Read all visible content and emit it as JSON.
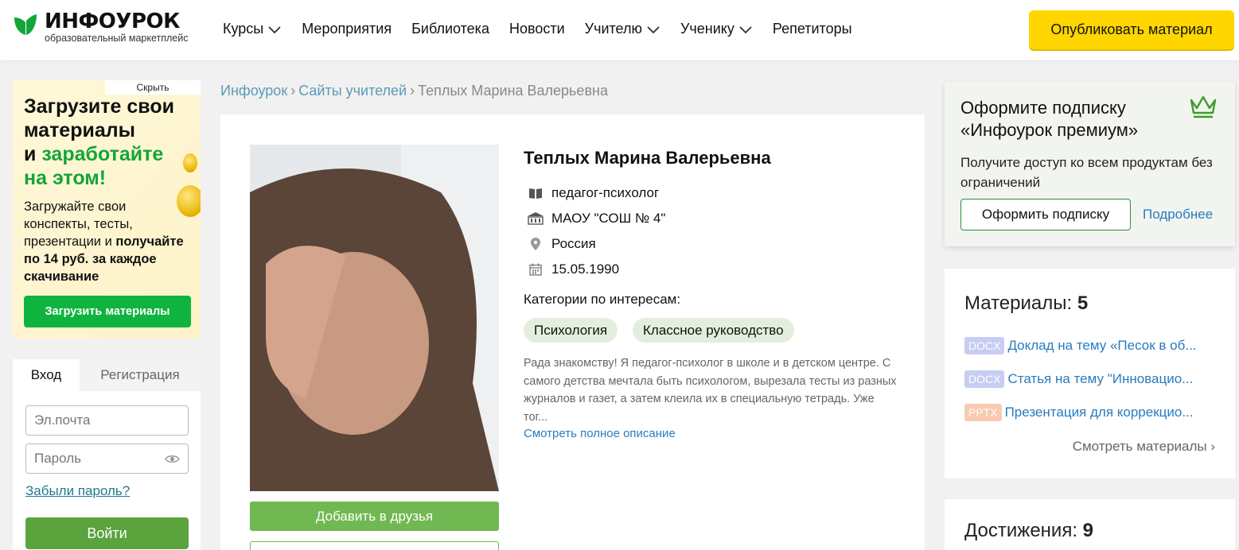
{
  "header": {
    "logo_name": "ИНФОУРОК",
    "logo_sub": "образовательный маркетплейс",
    "nav": [
      "Курсы",
      "Мероприятия",
      "Библиотека",
      "Новости",
      "Учителю",
      "Ученику",
      "Репетиторы"
    ],
    "publish_label": "Опубликовать материал"
  },
  "promo": {
    "hide_label": "Скрыть",
    "title_line1": "Загрузите свои",
    "title_line2": "материалы",
    "title_and": "и ",
    "title_green1": "заработайте",
    "title_green2": "на этом!",
    "text_plain": "Загружайте свои конспекты, тесты, презентации и",
    "text_bold": "получайте по 14 руб. за каждое скачивание",
    "button_label": "Загрузить материалы"
  },
  "login": {
    "tab_login": "Вход",
    "tab_register": "Регистрация",
    "email_placeholder": "Эл.почта",
    "password_placeholder": "Пароль",
    "forgot_label": "Забыли пароль?",
    "submit_label": "Войти"
  },
  "breadcrumb": {
    "home": "Инфоурок",
    "sites": "Сайты учителей",
    "current": "Теплых Марина Валерьевна",
    "sep": "›"
  },
  "profile": {
    "name": "Теплых Марина Валерьевна",
    "position": "педагог-психолог",
    "school": "МАОУ \"СОШ № 4\"",
    "country": "Россия",
    "birthdate": "15.05.1990",
    "categories_label": "Категории по интересам:",
    "categories": [
      "Психология",
      "Классное руководство"
    ],
    "about": "Рада знакомству! Я педагог-психолог в школе и в детском центре. С самого детства мечтала быть психологом, вырезала тесты из разных журналов и газет, а затем клеила их в специальную тетрадь. Уже тог...",
    "about_more": "Смотреть полное описание",
    "add_friend_label": "Добавить в друзья"
  },
  "premium": {
    "title": "Оформите подписку «Инфоурок премиум»",
    "text": "Получите доступ ко всем продуктам без ограничений",
    "button_label": "Оформить подписку",
    "more_label": "Подробнее"
  },
  "materials": {
    "label": "Материалы: ",
    "count": "5",
    "items": [
      {
        "type": "DOCX",
        "title": "Доклад на тему «Песок в об..."
      },
      {
        "type": "DOCX",
        "title": "Статья на тему \"Инновацио..."
      },
      {
        "type": "PPTX",
        "title": "Презентация для коррекцио..."
      }
    ],
    "more_label": "Смотреть материалы ›"
  },
  "achievements": {
    "label": "Достижения: ",
    "count": "9"
  },
  "colors": {
    "brand_green": "#14a538",
    "publish_yellow": "#ffd600",
    "link_blue": "#2a7bbd"
  }
}
